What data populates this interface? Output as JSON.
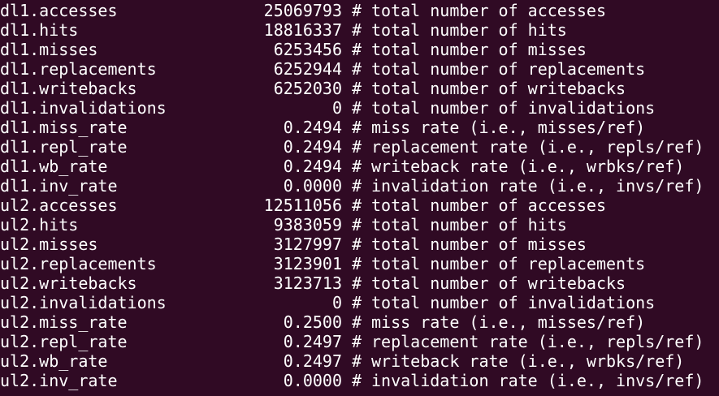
{
  "terminal": {
    "lines": [
      {
        "name": "dl1.accesses",
        "value": "25069793",
        "desc": "total number of accesses"
      },
      {
        "name": "dl1.hits",
        "value": "18816337",
        "desc": "total number of hits"
      },
      {
        "name": "dl1.misses",
        "value": "6253456",
        "desc": "total number of misses"
      },
      {
        "name": "dl1.replacements",
        "value": "6252944",
        "desc": "total number of replacements"
      },
      {
        "name": "dl1.writebacks",
        "value": "6252030",
        "desc": "total number of writebacks"
      },
      {
        "name": "dl1.invalidations",
        "value": "0",
        "desc": "total number of invalidations"
      },
      {
        "name": "dl1.miss_rate",
        "value": "0.2494",
        "desc": "miss rate (i.e., misses/ref)"
      },
      {
        "name": "dl1.repl_rate",
        "value": "0.2494",
        "desc": "replacement rate (i.e., repls/ref)"
      },
      {
        "name": "dl1.wb_rate",
        "value": "0.2494",
        "desc": "writeback rate (i.e., wrbks/ref)"
      },
      {
        "name": "dl1.inv_rate",
        "value": "0.0000",
        "desc": "invalidation rate (i.e., invs/ref)"
      },
      {
        "name": "ul2.accesses",
        "value": "12511056",
        "desc": "total number of accesses"
      },
      {
        "name": "ul2.hits",
        "value": "9383059",
        "desc": "total number of hits"
      },
      {
        "name": "ul2.misses",
        "value": "3127997",
        "desc": "total number of misses"
      },
      {
        "name": "ul2.replacements",
        "value": "3123901",
        "desc": "total number of replacements"
      },
      {
        "name": "ul2.writebacks",
        "value": "3123713",
        "desc": "total number of writebacks"
      },
      {
        "name": "ul2.invalidations",
        "value": "0",
        "desc": "total number of invalidations"
      },
      {
        "name": "ul2.miss_rate",
        "value": "0.2500",
        "desc": "miss rate (i.e., misses/ref)"
      },
      {
        "name": "ul2.repl_rate",
        "value": "0.2497",
        "desc": "replacement rate (i.e., repls/ref)"
      },
      {
        "name": "ul2.wb_rate",
        "value": "0.2497",
        "desc": "writeback rate (i.e., wrbks/ref)"
      },
      {
        "name": "ul2.inv_rate",
        "value": "0.0000",
        "desc": "invalidation rate (i.e., invs/ref)"
      }
    ],
    "comment_marker": "#"
  }
}
